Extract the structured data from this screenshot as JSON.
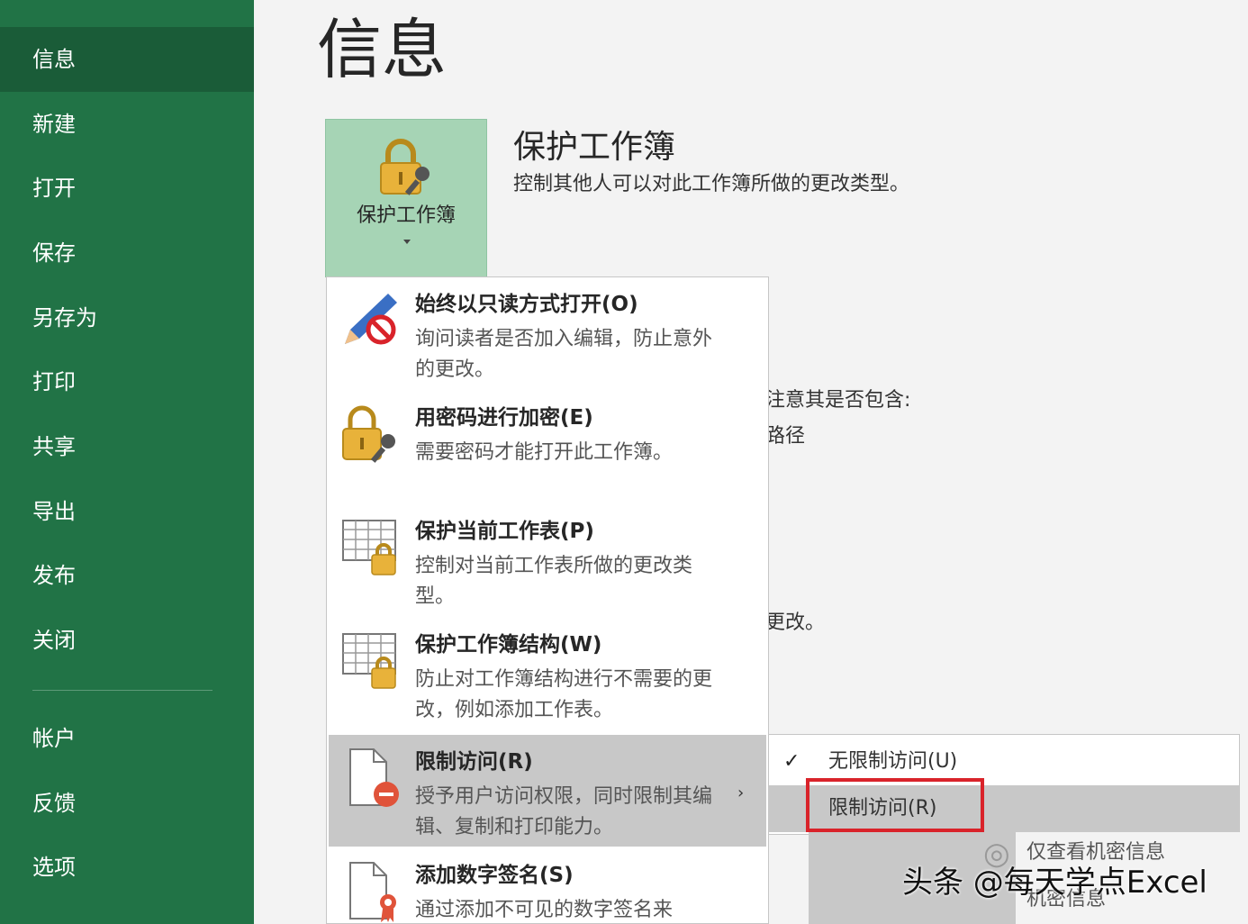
{
  "sidebar": {
    "items": [
      {
        "label": "信息",
        "selected": true
      },
      {
        "label": "新建"
      },
      {
        "label": "打开"
      },
      {
        "label": "保存"
      },
      {
        "label": "另存为"
      },
      {
        "label": "打印"
      },
      {
        "label": "共享"
      },
      {
        "label": "导出"
      },
      {
        "label": "发布"
      },
      {
        "label": "关闭"
      },
      {
        "label": "帐户"
      },
      {
        "label": "反馈"
      },
      {
        "label": "选项"
      }
    ]
  },
  "main": {
    "title": "信息",
    "protect_button_label": "保护工作簿",
    "section_heading": "保护工作簿",
    "section_desc": "控制其他人可以对此工作簿所做的更改类型。",
    "background_fragments": [
      "注意其是否包含:",
      "路径",
      "更改。"
    ]
  },
  "menu": {
    "items": [
      {
        "title": "始终以只读方式打开(O)",
        "desc": "询问读者是否加入编辑，防止意外的更改。"
      },
      {
        "title": "用密码进行加密(E)",
        "desc": "需要密码才能打开此工作簿。"
      },
      {
        "title": "保护当前工作表(P)",
        "desc": "控制对当前工作表所做的更改类型。"
      },
      {
        "title": "保护工作簿结构(W)",
        "desc": "防止对工作簿结构进行不需要的更改，例如添加工作表。"
      },
      {
        "title": "限制访问(R)",
        "desc": "授予用户访问权限，同时限制其编辑、复制和打印能力。"
      },
      {
        "title": "添加数字签名(S)",
        "desc": "通过添加不可见的数字签名来"
      }
    ]
  },
  "submenu": {
    "items": [
      {
        "label": "无限制访问(U)",
        "checked": true
      },
      {
        "label": "限制访问(R)"
      }
    ],
    "lower_text": "仅查看机密信息",
    "lower_text_2": "机密信息"
  },
  "watermark": "头条 @每天学点Excel",
  "colors": {
    "sidebar": "#217346",
    "accent_button": "#a6d4b5",
    "highlight_box": "#d9232a"
  }
}
